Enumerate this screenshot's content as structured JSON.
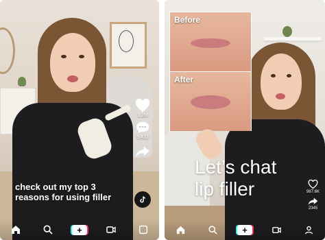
{
  "left_video": {
    "caption": "check out my top 3 reasons for using filler",
    "like_count": "1.2M",
    "comment_count": "5,432"
  },
  "right_video": {
    "before_label": "Before",
    "after_label": "After",
    "title_line1": "Let’s chat",
    "title_line2": "lip filler",
    "like_count": "987.6K",
    "share_count": "2345"
  },
  "nav": {
    "items": [
      "home-icon",
      "search-icon",
      "create-icon",
      "inbox-icon",
      "profile-icon"
    ],
    "create_glyph": "+"
  },
  "colors": {
    "accent_cyan": "#25f4ee",
    "accent_red": "#fe2c55",
    "text": "#ffffff"
  }
}
